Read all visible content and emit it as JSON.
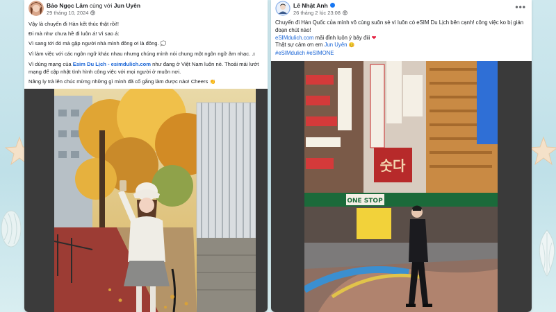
{
  "left_post": {
    "author": "Bảo Ngọc Lâm",
    "with_text": "cùng với",
    "tagged": "Jun Uyên",
    "date": "29 tháng 10, 2024",
    "lines": {
      "l1": "Vậy là chuyến đi Hàn kết thúc thật rồi!!",
      "l2": "Đi mà như chưa hề đi luôn á! Vì sao á:",
      "l3": "Vì sang tới đó mà gặp người nhà mình đông ơi là đông.",
      "l4": "Vì làm việc với các ngôn ngữ khác nhau nhưng chúng mình nói chung một ngôn ngữ âm nhạc.",
      "l5a": "Vì dùng mạng của ",
      "l5link": "Esim Du Lịch - esimdulich.com",
      "l5b": " như đang ở Việt Nam luôn nè. Thoải mái lướt mạng để cập nhật tình hình công việc với mọi người ở muôn nơi.",
      "l6": "Nâng ly trà lên chúc mừng những gì mình đã cố gắng làm được nào! Cheers"
    }
  },
  "right_post": {
    "author": "Lê Nhật Anh",
    "date": "26 tháng 2 lúc 23:08",
    "line1": "Chuyến đi Hàn Quốc của mình vô cùng suôn sẻ vì luôn có eSIM Du Lịch bên cạnh! công việc ko bị gián đoạn chút nào!",
    "line2_link": "eSIMdulich.com",
    "line2_rest": " mãi đỉnh luôn ý bây điii",
    "line3_a": "Thật sự cảm ơn em ",
    "line3_tag": "Jun Uyên",
    "hashtags": "#eSIMdulich #eSIMONE"
  },
  "colors": {
    "link": "#1a65d6",
    "verified": "#1877f2",
    "text": "#1c1e21",
    "meta": "#65676b",
    "background": "#cfe8ee"
  },
  "icons": [
    "globe-icon",
    "verified-badge-icon",
    "more-options-icon",
    "close-icon",
    "starfish-icon",
    "seashell-icon"
  ]
}
